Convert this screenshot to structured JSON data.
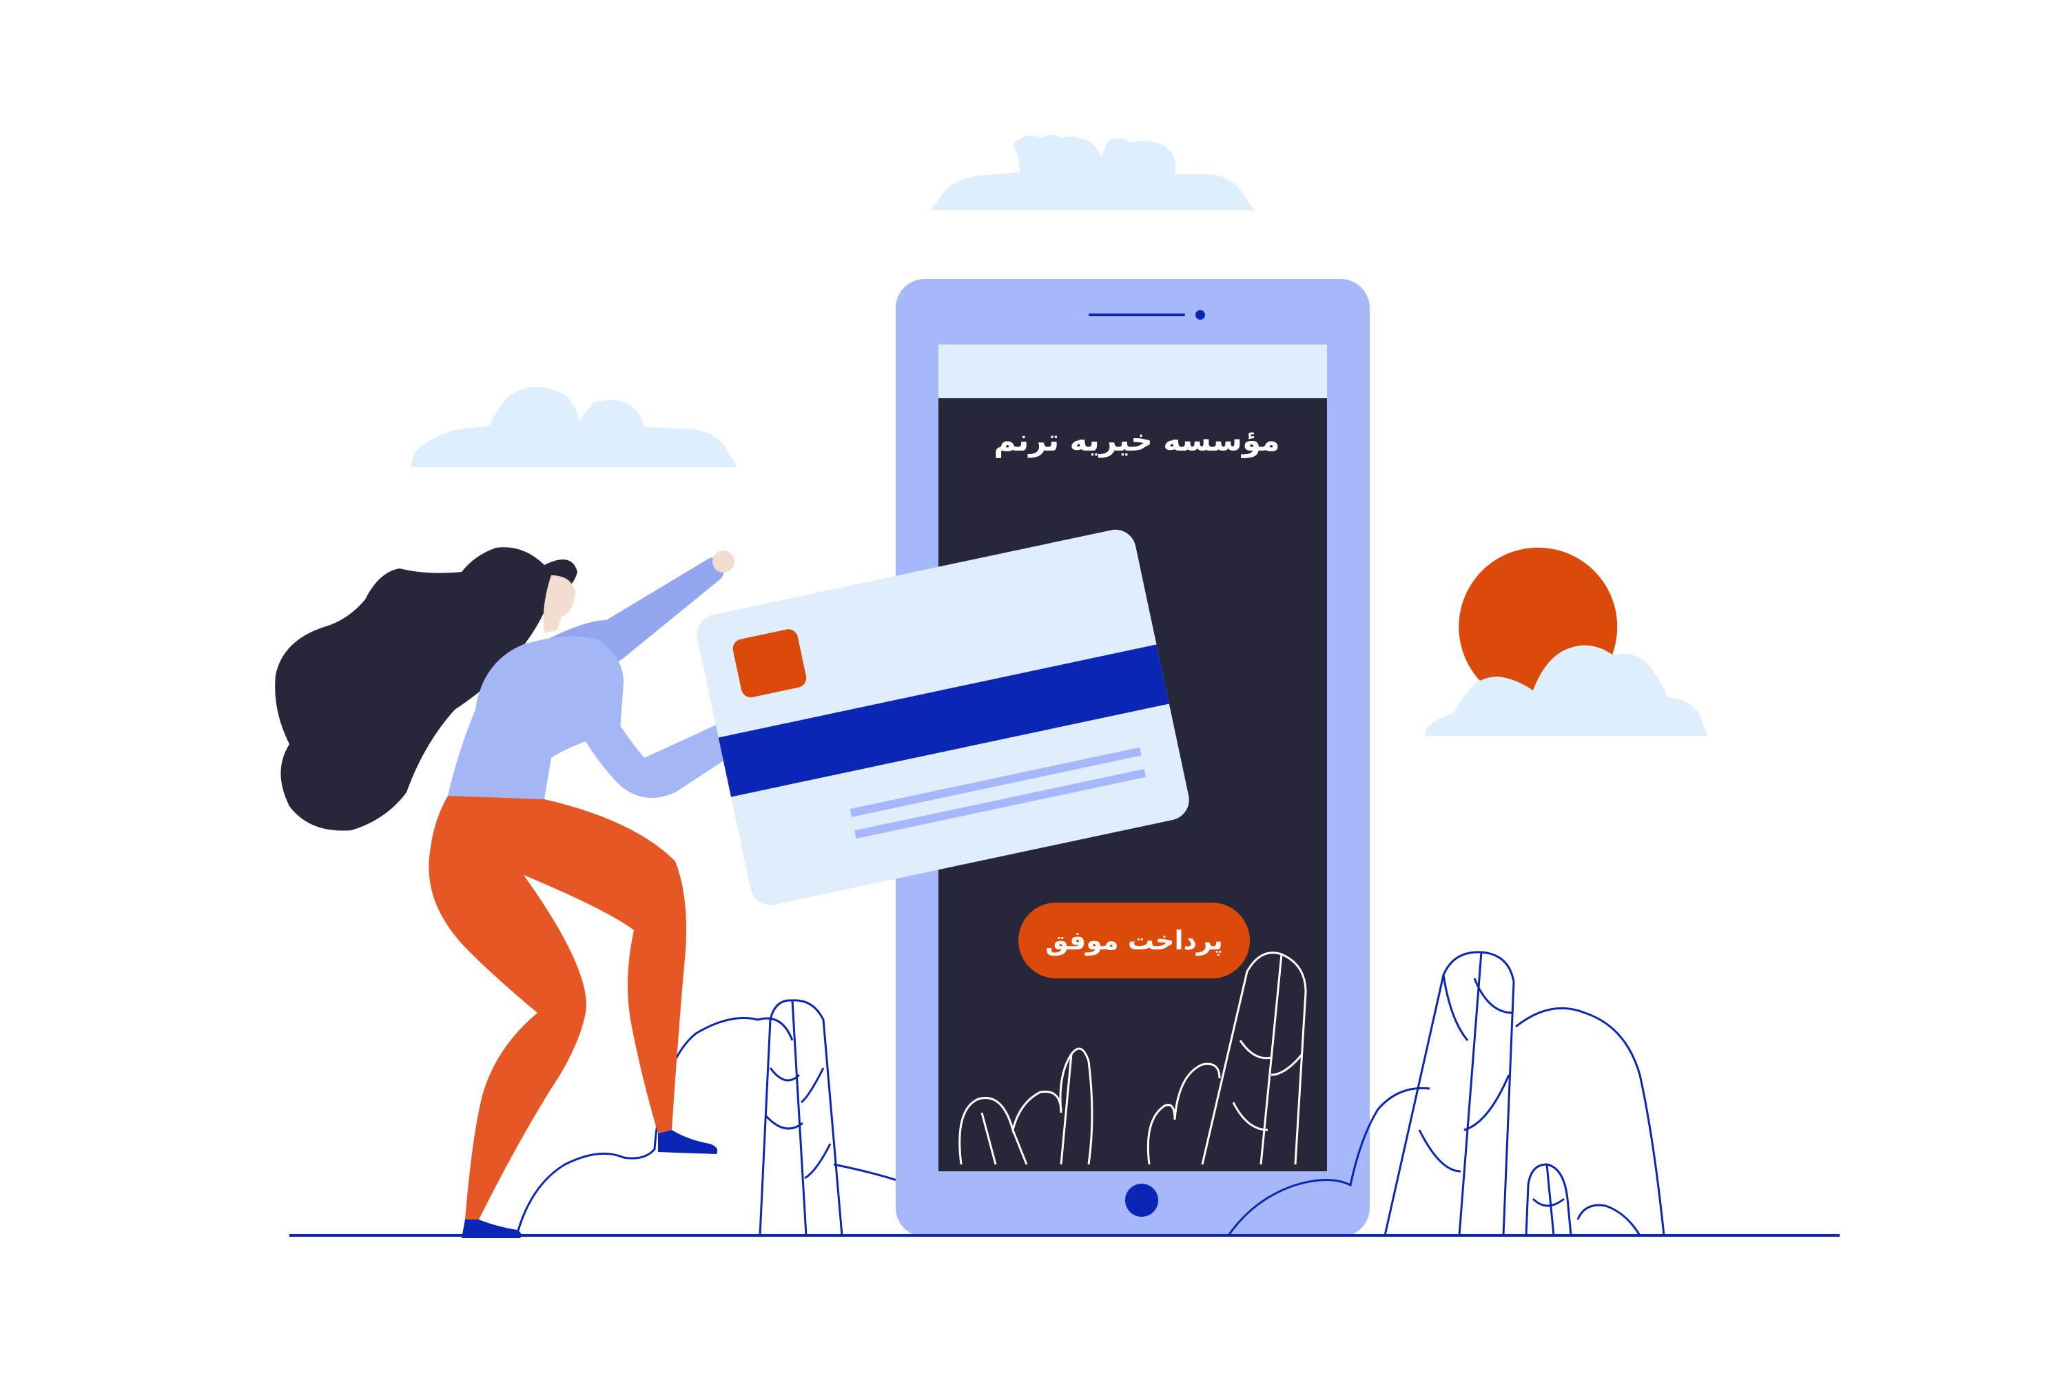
{
  "phone": {
    "organization_name": "مؤسسه خیریه ترنم",
    "status_button_label": "پرداخت موفق"
  },
  "colors": {
    "phone_body": "#a7b8fa",
    "screen_dark": "#262839",
    "screen_header": "#e0edfb",
    "accent_orange": "#dc4a0a",
    "card_stripe": "#0b25b5",
    "line_art": "#0b25b5",
    "cloud": "#dfeefc",
    "sun": "#dc4a0a",
    "pants": "#e55725",
    "shirt": "#a5b6f6",
    "hair": "#262839"
  },
  "icons": {
    "phone_home_button": "circle-button-icon",
    "phone_speaker": "speaker-slot-icon",
    "card_chip": "card-chip-icon"
  }
}
